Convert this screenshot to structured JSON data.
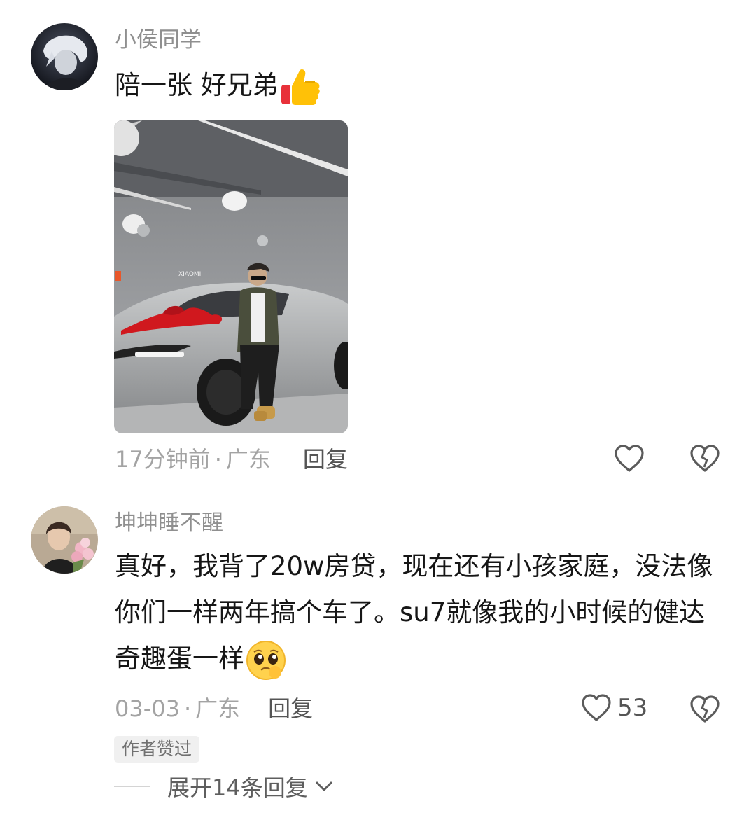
{
  "comments": [
    {
      "username": "小侯同学",
      "text": "陪一张 好兄弟",
      "emoji": "thumbs-up-icon",
      "time": "17分钟前",
      "separator": "·",
      "location": "广东",
      "reply_label": "回复",
      "photo_sign": "XIAOMI"
    },
    {
      "username": "坤坤睡不醒",
      "text": "真好，我背了20w房贷，现在还有小孩家庭，没法像你们一样两年搞个车了。su7就像我的小时候的健达奇趣蛋一样",
      "emoji": "pleading-face-icon",
      "time": "03-03",
      "separator": "·",
      "location": "广东",
      "reply_label": "回复",
      "like_count": "53",
      "badge": "作者赞过",
      "expand_label": "展开14条回复"
    }
  ],
  "colors": {
    "username": "#8f8f8f",
    "meta": "#a3a3a3",
    "thumb_red": "#e8313a",
    "thumb_yellow": "#ffc107",
    "car_bow": "#d0181e"
  }
}
